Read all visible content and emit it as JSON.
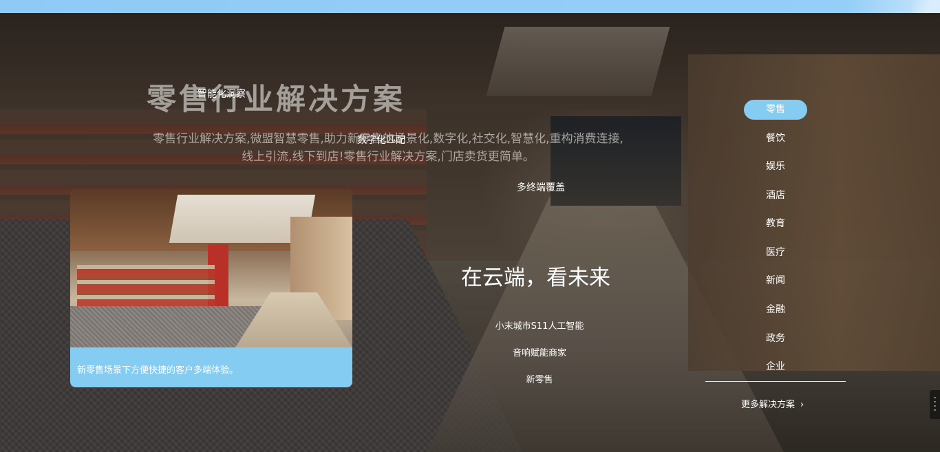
{
  "hero": {
    "title": "零售行业解决方案",
    "description": "零售行业解决方案,微盟智慧零售,助力新零售的场景化,数字化,社交化,智慧化,重构消费连接,线上引流,线下到店!零售行业解决方案,门店卖货更简单。"
  },
  "floating_labels": {
    "insight": "智能化洞察",
    "match": "数字化匹配",
    "coverage": "多终端覆盖"
  },
  "card": {
    "caption": "新零售场景下方便快捷的客户多端体验。"
  },
  "center": {
    "slogan": "在云端，看未来",
    "links": [
      "小末城市S11人工智能",
      "音响赋能商家",
      "新零售"
    ]
  },
  "side_nav": {
    "items": [
      {
        "label": "零售",
        "active": true
      },
      {
        "label": "餐饮",
        "active": false
      },
      {
        "label": "娱乐",
        "active": false
      },
      {
        "label": "酒店",
        "active": false
      },
      {
        "label": "教育",
        "active": false
      },
      {
        "label": "医疗",
        "active": false
      },
      {
        "label": "新闻",
        "active": false
      },
      {
        "label": "金融",
        "active": false
      },
      {
        "label": "政务",
        "active": false
      },
      {
        "label": "企业",
        "active": false
      }
    ],
    "more_label": "更多解决方案",
    "more_icon": "chevron-right-icon"
  },
  "colors": {
    "accent": "#84ccf2",
    "top_strip": "#8fcaf6"
  }
}
